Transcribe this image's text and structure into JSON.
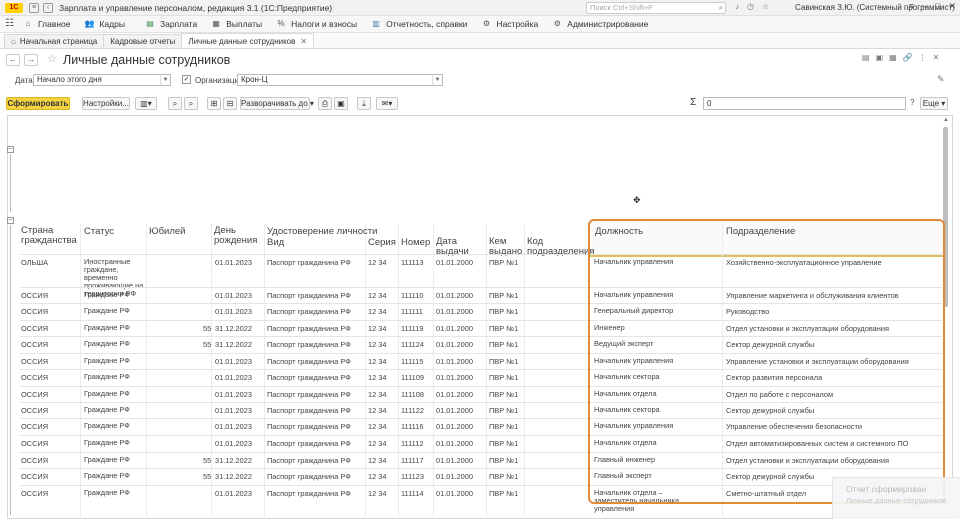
{
  "app": {
    "logo": "1С",
    "title": "Зарплата и управление персоналом, редакция 3.1  (1С:Предприятие)",
    "search_placeholder": "Поиск Ctrl+Shift+F",
    "user": "Савинская З.Ю. (Системный программист)"
  },
  "menu": [
    {
      "label": "Главное",
      "icon": "home-icon",
      "color": "#555555"
    },
    {
      "label": "Кадры",
      "icon": "people-icon",
      "color": "#4a7ab5"
    },
    {
      "label": "Зарплата",
      "icon": "payroll-icon",
      "color": "#3c8a3c"
    },
    {
      "label": "Выплаты",
      "icon": "payments-icon",
      "color": "#555555"
    },
    {
      "label": "Налоги и взносы",
      "icon": "percent-icon",
      "color": "#555555"
    },
    {
      "label": "Отчетность, справки",
      "icon": "reports-icon",
      "color": "#4a7ab5"
    },
    {
      "label": "Настройка",
      "icon": "gear-icon",
      "color": "#555555"
    },
    {
      "label": "Администрирование",
      "icon": "admin-gear-icon",
      "color": "#555555"
    }
  ],
  "tabs": [
    {
      "label": "Начальная страница",
      "active": false
    },
    {
      "label": "Кадровые отчеты",
      "active": false
    },
    {
      "label": "Личные данные сотрудников",
      "active": true
    }
  ],
  "form": {
    "title": "Личные данные сотрудников",
    "date_label": "Дата:",
    "date_value": "Начало этого дня",
    "org_label": "Организация:",
    "org_value": "Крон-Ц",
    "org_checked": true
  },
  "toolbar": {
    "generate": "Сформировать",
    "settings": "Настройки...",
    "expand": "Разворачивать до",
    "sum_value": "0",
    "help": "?",
    "more": "Еще"
  },
  "report": {
    "header": {
      "country": "Страна гражданства",
      "status": "Статус",
      "jubilee": "Юбилей",
      "birth_day": "День рождения",
      "id_doc": "Удостоверение личности",
      "kind": "Вид",
      "series": "Серия",
      "number": "Номер",
      "issue_date": "Дата выдачи",
      "issued_by": "Кем выдано",
      "dept_code": "Код подразделения",
      "position": "Должность",
      "department": "Подразделение"
    },
    "rows": [
      {
        "country": "ОЛЬША",
        "status": "Иностранные граждане, временно проживающие на территории РФ",
        "jubilee": "",
        "birth": "01.01.2023",
        "kind": "Паспорт гражданина РФ",
        "series": "12 34",
        "number": "111113",
        "issued": "01.01.2000",
        "by": "ПВР №1",
        "position": "Начальник управления",
        "department": "Хозяйственно-эксплуатационное управление"
      },
      {
        "country": "ОССИЯ",
        "status": "Граждане РФ",
        "jubilee": "",
        "birth": "01.01.2023",
        "kind": "Паспорт гражданина РФ",
        "series": "12 34",
        "number": "111110",
        "issued": "01.01.2000",
        "by": "ПВР №1",
        "position": "Начальник управления",
        "department": "Управление маркетинга и обслуживания клиентов"
      },
      {
        "country": "ОССИЯ",
        "status": "Граждане РФ",
        "jubilee": "",
        "birth": "01.01.2023",
        "kind": "Паспорт гражданина РФ",
        "series": "12 34",
        "number": "111111",
        "issued": "01.01.2000",
        "by": "ПВР №1",
        "position": "Генеральный директор",
        "department": "Руководство"
      },
      {
        "country": "ОССИЯ",
        "status": "Граждане РФ",
        "jubilee": "55",
        "birth": "31.12.2022",
        "kind": "Паспорт гражданина РФ",
        "series": "12 34",
        "number": "111119",
        "issued": "01.01.2000",
        "by": "ПВР №1",
        "position": "Инженер",
        "department": "Отдел установки и эксплуатации оборудования"
      },
      {
        "country": "ОССИЯ",
        "status": "Граждане РФ",
        "jubilee": "55",
        "birth": "31.12.2022",
        "kind": "Паспорт гражданина РФ",
        "series": "12 34",
        "number": "111124",
        "issued": "01.01.2000",
        "by": "ПВР №1",
        "position": "Ведущий эксперт",
        "department": "Сектор дежурной службы"
      },
      {
        "country": "ОССИЯ",
        "status": "Граждане РФ",
        "jubilee": "",
        "birth": "01.01.2023",
        "kind": "Паспорт гражданина РФ",
        "series": "12 34",
        "number": "111115",
        "issued": "01.01.2000",
        "by": "ПВР №1",
        "position": "Начальник управления",
        "department": "Управление установки и эксплуатации оборудования"
      },
      {
        "country": "ОССИЯ",
        "status": "Граждане РФ",
        "jubilee": "",
        "birth": "01.01.2023",
        "kind": "Паспорт гражданина РФ",
        "series": "12 34",
        "number": "111109",
        "issued": "01.01.2000",
        "by": "ПВР №1",
        "position": "Начальник сектора",
        "department": "Сектор развития персонала"
      },
      {
        "country": "ОССИЯ",
        "status": "Граждане РФ",
        "jubilee": "",
        "birth": "01.01.2023",
        "kind": "Паспорт гражданина РФ",
        "series": "12 34",
        "number": "111108",
        "issued": "01.01.2000",
        "by": "ПВР №1",
        "position": "Начальник отдела",
        "department": "Отдел по работе с персоналом"
      },
      {
        "country": "ОССИЯ",
        "status": "Граждане РФ",
        "jubilee": "",
        "birth": "01.01.2023",
        "kind": "Паспорт гражданина РФ",
        "series": "12 34",
        "number": "111122",
        "issued": "01.01.2000",
        "by": "ПВР №1",
        "position": "Начальник сектора",
        "department": "Сектор дежурной службы"
      },
      {
        "country": "ОССИЯ",
        "status": "Граждане РФ",
        "jubilee": "",
        "birth": "01.01.2023",
        "kind": "Паспорт гражданина РФ",
        "series": "12 34",
        "number": "111116",
        "issued": "01.01.2000",
        "by": "ПВР №1",
        "position": "Начальник управления",
        "department": "Управление обеспечения безопасности"
      },
      {
        "country": "ОССИЯ",
        "status": "Граждане РФ",
        "jubilee": "",
        "birth": "01.01.2023",
        "kind": "Паспорт гражданина РФ",
        "series": "12 34",
        "number": "111112",
        "issued": "01.01.2000",
        "by": "ПВР №1",
        "position": "Начальник отдела",
        "department": "Отдел автоматизированных систем и системного ПО"
      },
      {
        "country": "ОССИЯ",
        "status": "Граждане РФ",
        "jubilee": "55",
        "birth": "31.12.2022",
        "kind": "Паспорт гражданина РФ",
        "series": "12 34",
        "number": "111117",
        "issued": "01.01.2000",
        "by": "ПВР №1",
        "position": "Главный инженер",
        "department": "Отдел установки и эксплуатации оборудования"
      },
      {
        "country": "ОССИЯ",
        "status": "Граждане РФ",
        "jubilee": "55",
        "birth": "31.12.2022",
        "kind": "Паспорт гражданина РФ",
        "series": "12 34",
        "number": "111123",
        "issued": "01.01.2000",
        "by": "ПВР №1",
        "position": "Главный эксперт",
        "department": "Сектор дежурной службы"
      },
      {
        "country": "ОССИЯ",
        "status": "Граждане РФ",
        "jubilee": "",
        "birth": "01.01.2023",
        "kind": "Паспорт гражданина РФ",
        "series": "12 34",
        "number": "111114",
        "issued": "01.01.2000",
        "by": "ПВР №1",
        "position": "Начальник отдела – заместитель начальника управления",
        "department": "Сметно-штатный отдел"
      }
    ]
  },
  "toast": {
    "title": "Отчет сформирован",
    "text": "Личные данные сотрудников"
  },
  "colors": {
    "primary_button": "#f5d442",
    "highlight_border": "#e08a3a"
  }
}
